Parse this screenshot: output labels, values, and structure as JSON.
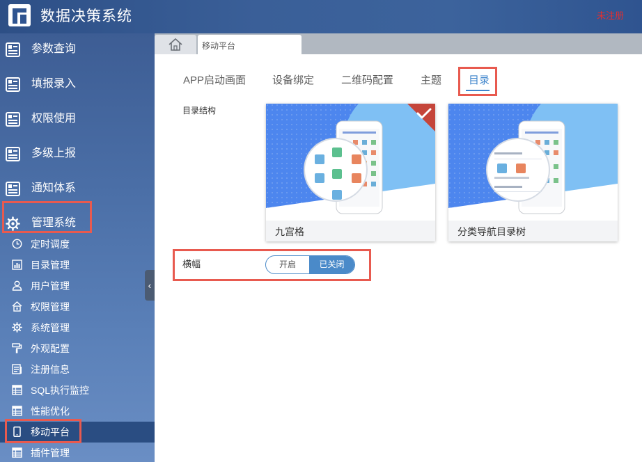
{
  "header": {
    "title": "数据决策系统",
    "registration_status": "未注册"
  },
  "sidebar": {
    "nav": [
      {
        "label": "参数查询",
        "icon": "report-icon"
      },
      {
        "label": "填报录入",
        "icon": "report-icon"
      },
      {
        "label": "权限使用",
        "icon": "report-icon"
      },
      {
        "label": "多级上报",
        "icon": "report-icon"
      },
      {
        "label": "通知体系",
        "icon": "report-icon"
      },
      {
        "label": "管理系统",
        "icon": "gear-icon"
      }
    ],
    "sub": [
      {
        "label": "定时调度",
        "icon": "clock-icon"
      },
      {
        "label": "目录管理",
        "icon": "catalog-icon"
      },
      {
        "label": "用户管理",
        "icon": "user-icon"
      },
      {
        "label": "权限管理",
        "icon": "lock-icon"
      },
      {
        "label": "系统管理",
        "icon": "gear-icon"
      },
      {
        "label": "外观配置",
        "icon": "paint-roller-icon"
      },
      {
        "label": "注册信息",
        "icon": "register-icon"
      },
      {
        "label": "SQL执行监控",
        "icon": "table-icon"
      },
      {
        "label": "性能优化",
        "icon": "table-icon"
      },
      {
        "label": "移动平台",
        "icon": "mobile-icon",
        "active": true
      },
      {
        "label": "插件管理",
        "icon": "table-icon"
      }
    ]
  },
  "tabs": {
    "home_icon": "home-icon",
    "active_tab": "移动平台"
  },
  "main": {
    "subtabs": [
      "APP启动画面",
      "设备绑定",
      "二维码配置",
      "主题",
      "目录"
    ],
    "active_subtab": "目录",
    "structure_label": "目录结构",
    "cards": [
      {
        "label": "九宫格",
        "selected": true
      },
      {
        "label": "分类导航目录树",
        "selected": false
      }
    ],
    "banner_label": "横幅",
    "switch": {
      "on_label": "开启",
      "off_label": "已关闭",
      "state": "已关闭"
    }
  },
  "colors": {
    "accent": "#3f85cc",
    "highlight": "#e85a4f",
    "unregistered": "#e62e2e",
    "sidebar_active": "#2a4d82"
  }
}
